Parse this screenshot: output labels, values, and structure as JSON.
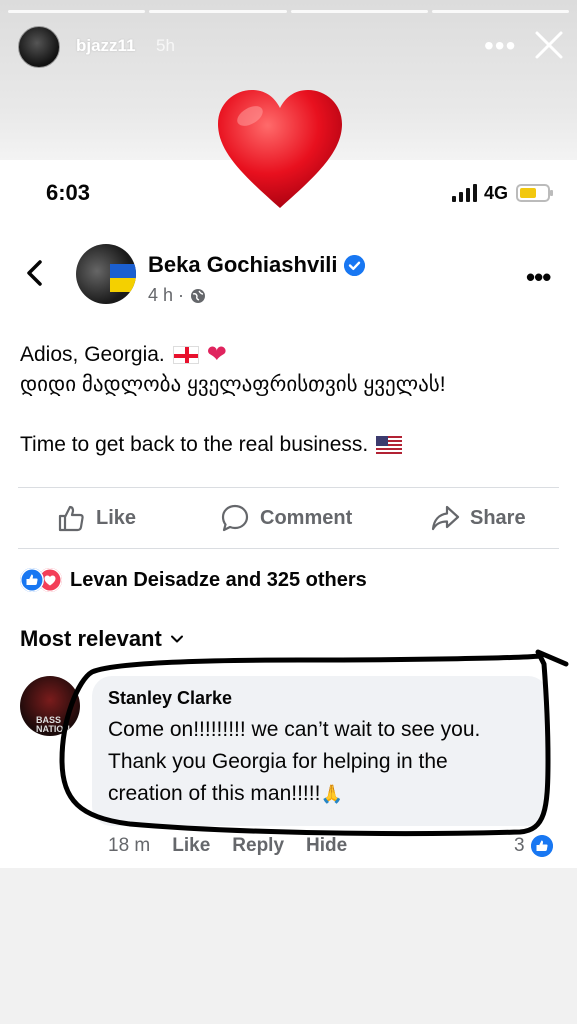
{
  "story": {
    "username": "bjazz11",
    "time_ago": "5h",
    "progress_segments": 4
  },
  "status_bar": {
    "time": "6:03",
    "network": "4G",
    "battery_level": 0.6
  },
  "post": {
    "author": "Beka Gochiashvili",
    "meta": "4 h ·",
    "lines": [
      "Adios, Georgia.",
      "დიდი მადლობა ყველაფრისთვის ყველას!",
      "",
      "Time to get back to the real business."
    ]
  },
  "actions": {
    "like": "Like",
    "comment": "Comment",
    "share": "Share"
  },
  "reactions": {
    "summary": "Levan Deisadze and 325 others"
  },
  "comments_sort": "Most relevant",
  "comment": {
    "author": "Stanley Clarke",
    "avatar_text": "BASS NATION",
    "text_lines": [
      "Come on!!!!!!!!! we can’t wait to see you.",
      "Thank you Georgia for helping in the",
      "creation of this man!!!!!"
    ],
    "time": "18 m",
    "like": "Like",
    "reply": "Reply",
    "hide": "Hide",
    "like_count": "3"
  },
  "colors": {
    "facebook_blue": "#1877f2",
    "love_red": "#f33e58",
    "secondary_text": "#65676b",
    "bubble_bg": "#f0f2f5"
  }
}
